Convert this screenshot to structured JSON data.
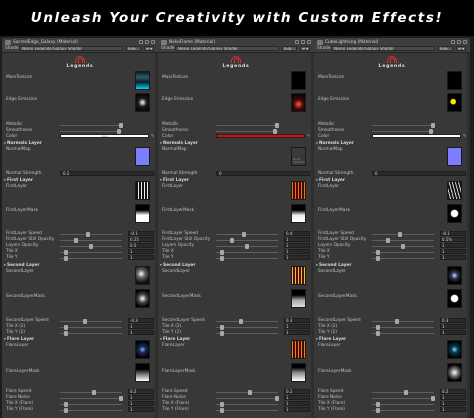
{
  "banner": {
    "title": "Unleash Your Creativity with Custom Effects!"
  },
  "logo": {
    "text": "Legends"
  },
  "header": {
    "shader_label": "Shader",
    "shader_value": "Nekio Legends/Galaxy Shader",
    "edit_label": "Edit...",
    "menu_label": "≡ ▾"
  },
  "colors": {
    "banner_bg": "#000000",
    "panel_bg": "#383838",
    "accent": "#d9322e"
  },
  "panels": [
    {
      "title": "SacredEdge_Galaxy (Material)",
      "fields": {
        "main_texture": "MainTexture",
        "edge_emission": "Edge Emission",
        "metallic": "Metallic",
        "smoothness": "Smoothness",
        "color": "Color",
        "normals_layer": "Normals Layer",
        "normal_map": "NormalMap",
        "normal_strength": "Normal Strength",
        "first_layer": "First Layer",
        "first_layer_tex": "FirstLayer",
        "first_layer_mask": "FirstLayerMask",
        "first_layer_speed": "FirstLayer Speed",
        "first_layer_still_opacity": "FirstLayer Still Opacity",
        "layers_opacity": "Layers Opacity",
        "tile_x": "Tile X",
        "tile_y": "Tile Y",
        "second_layer": "Second Layer",
        "second_layer_tex": "SecondLayer",
        "second_layer_mask": "SecondLayerMask",
        "second_layer_speed": "SecondLayer Speed",
        "tile_x2": "Tile X (2)",
        "tile_y2": "Tile Y (2)",
        "flare_layer": "Flare Layer",
        "flare_layer_tex": "FlareLayer",
        "flare_layer_mask": "FlareLayerMask",
        "flare_speed": "Flare Speed",
        "flare_noise": "Flare Noise",
        "tile_x_flare": "Tile X (Flare)",
        "tile_y_flare": "Tile Y (Flare)"
      },
      "values": {
        "normal_strength": "0.2",
        "first_layer_speed": "-0.1",
        "first_layer_still_opacity": "0.25",
        "layers_opacity": "0.5",
        "tile_x": "1",
        "tile_y": "1",
        "second_layer_speed": "-0.3",
        "tile_x2": "1",
        "tile_y2": "1",
        "flare_speed": "0.2",
        "flare_noise": "1",
        "tile_x_flare": "1",
        "tile_y_flare": "1"
      },
      "color_swatch": "#ffffff",
      "color_swatch_text": "none"
    },
    {
      "title": "NekoFlame (Material)",
      "fields": {
        "main_texture": "MainTexture",
        "edge_emission": "Edge Emission",
        "metallic": "Metallic",
        "smoothness": "Smoothness",
        "color": "Color",
        "normals_layer": "Normals Layer",
        "normal_map": "NormalMap",
        "normal_strength": "Normal Strength",
        "first_layer": "First Layer",
        "first_layer_tex": "FirstLayer",
        "first_layer_mask": "FirstLayerMask",
        "first_layer_speed": "FirstLayer Speed",
        "first_layer_still_opacity": "FirstLayer Still Opacity",
        "layers_opacity": "Layers Opacity",
        "tile_x": "Tile X",
        "tile_y": "Tile Y",
        "second_layer": "Second Layer",
        "second_layer_tex": "SecondLayer",
        "second_layer_mask": "SecondLayerMask",
        "second_layer_speed": "SecondLayer Speed",
        "tile_x2": "Tile X (2)",
        "tile_y2": "Tile Y (2)",
        "flare_layer": "Flare Layer",
        "flare_layer_tex": "FlareLayer",
        "flare_layer_mask": "FlareLayerMask",
        "flare_speed": "Flare Speed",
        "flare_noise": "Flare Noise",
        "tile_x_flare": "Tile X (Flare)",
        "tile_y_flare": "Tile Y (Flare)"
      },
      "values": {
        "normal_strength": "0",
        "first_layer_speed": "0.4",
        "first_layer_still_opacity": "1",
        "layers_opacity": "1",
        "tile_x": "1",
        "tile_y": "1",
        "second_layer_speed": "0.3",
        "tile_x2": "1",
        "tile_y2": "1",
        "flare_speed": "0.2",
        "flare_noise": "1",
        "tile_x_flare": "1",
        "tile_y_flare": "1"
      },
      "color_swatch": "#d80c0c",
      "color_swatch_text": "",
      "normal_map_placeholder": "None (Texture)"
    },
    {
      "title": "CubeLightning (Material)",
      "fields": {
        "main_texture": "MainTexture",
        "edge_emission": "Edge Emission",
        "metallic": "Metallic",
        "smoothness": "Smoothness",
        "color": "Color",
        "normals_layer": "Normals Layer",
        "normal_map": "NormalMap",
        "normal_strength": "Normal Strength",
        "first_layer": "First Layer",
        "first_layer_tex": "FirstLayer",
        "first_layer_mask": "FirstLayerMask",
        "first_layer_speed": "FirstLayer Speed",
        "first_layer_still_opacity": "FirstLayer Still Opacity",
        "layers_opacity": "Layers Opacity",
        "tile_x": "Tile X",
        "tile_y": "Tile Y",
        "second_layer": "Second Layer",
        "second_layer_tex": "SecondLayer",
        "second_layer_mask": "SecondLayerMask",
        "second_layer_speed": "SecondLayer Speed",
        "tile_x2": "Tile X (2)",
        "tile_y2": "Tile Y (2)",
        "flare_layer": "Flare Layer",
        "flare_layer_tex": "FlareLayer",
        "flare_layer_mask": "FlareLayerMask",
        "flare_speed": "Flare Speed",
        "flare_noise": "Flare Noise",
        "tile_x_flare": "Tile X (Flare)",
        "tile_y_flare": "Tile Y (Flare)"
      },
      "values": {
        "normal_strength": "0",
        "first_layer_speed": "-0.1",
        "first_layer_still_opacity": "0.5%",
        "layers_opacity": "1",
        "tile_x": "1",
        "tile_y": "1",
        "second_layer_speed": "0.3",
        "tile_x2": "1",
        "tile_y2": "1",
        "flare_speed": "0.2",
        "flare_noise": "1",
        "tile_x_flare": "1",
        "tile_y_flare": "1"
      },
      "color_swatch": "#ffffff",
      "color_swatch_text": ""
    }
  ]
}
